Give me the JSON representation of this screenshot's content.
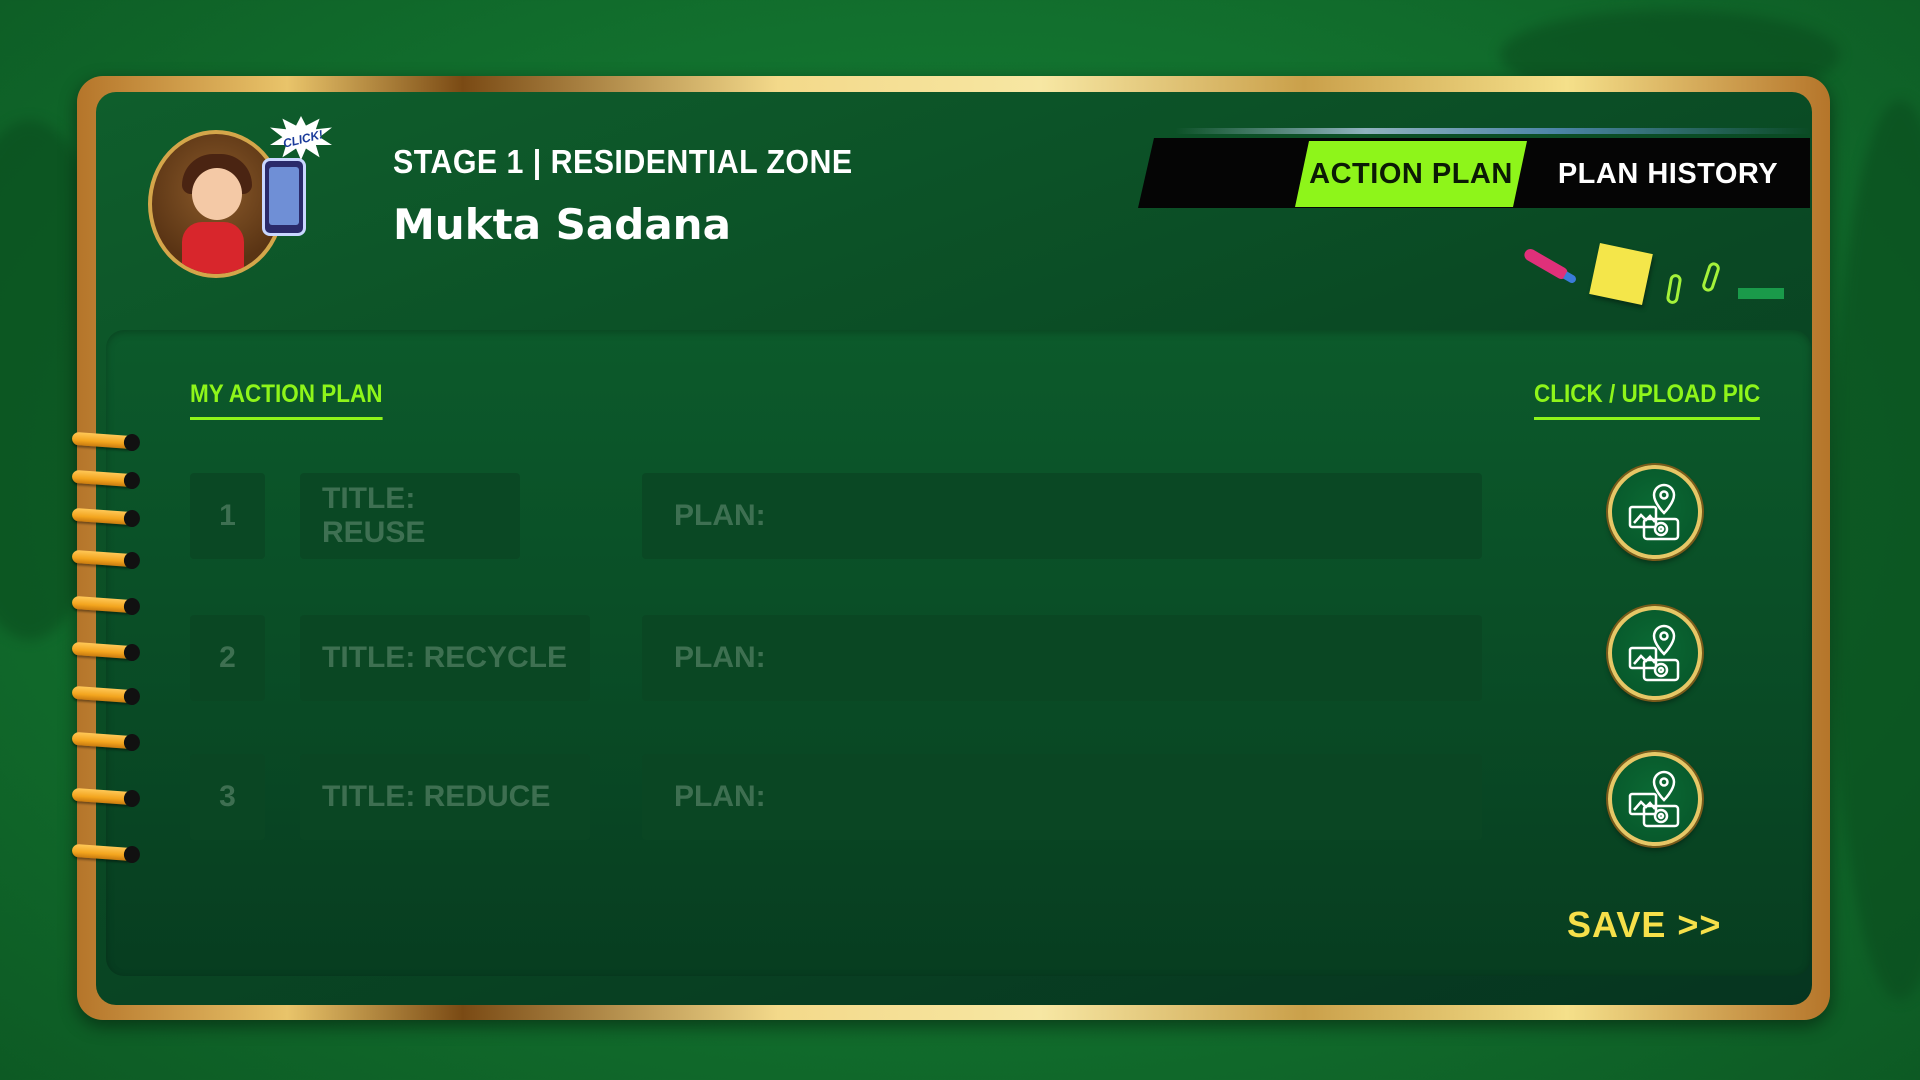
{
  "header": {
    "stage_label": "STAGE 1 | RESIDENTIAL ZONE",
    "player_name": "Mukta Sadana",
    "avatar_badge": "CLICK!"
  },
  "tabs": [
    {
      "label": "ACTION PLAN",
      "active": true
    },
    {
      "label": "PLAN HISTORY",
      "active": false
    }
  ],
  "sections": {
    "left_heading": "MY ACTION PLAN",
    "right_heading": "CLICK / UPLOAD PIC"
  },
  "plan_rows": [
    {
      "number": "1",
      "title": "TITLE: REUSE",
      "plan": "PLAN:"
    },
    {
      "number": "2",
      "title": "TITLE: RECYCLE",
      "plan": "PLAN:"
    },
    {
      "number": "3",
      "title": "TITLE: REDUCE",
      "plan": "PLAN:"
    }
  ],
  "upload_icon": "camera-location-icon",
  "save_label": "SAVE >>",
  "colors": {
    "accent_green": "#8ef51a",
    "save_yellow": "#f6e04a",
    "board_green": "#0a4a24",
    "frame_gold": "#e9c46a",
    "ring_orange": "#f3a51e"
  }
}
